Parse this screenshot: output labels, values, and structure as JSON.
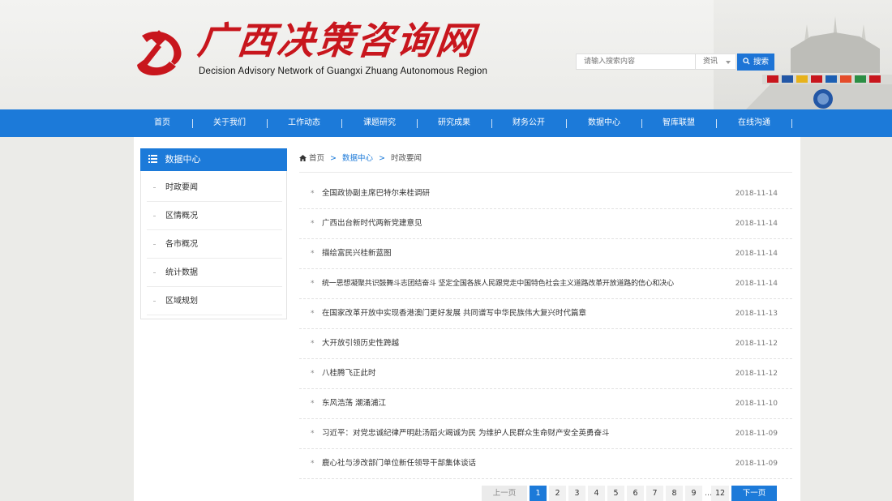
{
  "header": {
    "logo_title": "广西决策咨询网",
    "logo_subtitle": "Decision Advisory Network of Guangxi Zhuang Autonomous Region",
    "search_placeholder": "请输入搜索内容",
    "search_scope": "资讯",
    "search_button": "搜索"
  },
  "nav": {
    "items": [
      "首页",
      "关于我们",
      "工作动态",
      "课题研究",
      "研究成果",
      "财务公开",
      "数据中心",
      "智库联盟",
      "在线沟通"
    ]
  },
  "sidebar": {
    "title": "数据中心",
    "items": [
      "时政要闻",
      "区情概况",
      "各市概况",
      "统计数据",
      "区域规划"
    ]
  },
  "breadcrumb": {
    "home": "首页",
    "section": "数据中心",
    "current": "时政要闻",
    "separator": ">"
  },
  "news": [
    {
      "title": "全国政协副主席巴特尔来桂调研",
      "date": "2018-11-14"
    },
    {
      "title": "广西出台新时代两新党建意见",
      "date": "2018-11-14"
    },
    {
      "title": "描绘富民兴桂新蓝图",
      "date": "2018-11-14"
    },
    {
      "title": "统一思想凝聚共识鼓舞斗志团结奋斗 坚定全国各族人民跟党走中国特色社会主义道路改革开放道路的信心和决心",
      "date": "2018-11-14"
    },
    {
      "title": "在国家改革开放中实现香港澳门更好发展 共同谱写中华民族伟大复兴时代篇章",
      "date": "2018-11-13"
    },
    {
      "title": "大开放引领历史性跨越",
      "date": "2018-11-12"
    },
    {
      "title": "八桂腾飞正此时",
      "date": "2018-11-12"
    },
    {
      "title": "东风浩荡 潮涌浦江",
      "date": "2018-11-10"
    },
    {
      "title": "习近平：对党忠诚纪律严明赴汤蹈火竭诚为民 为维护人民群众生命财产安全英勇奋斗",
      "date": "2018-11-09"
    },
    {
      "title": "鹿心社与涉改部门单位新任领导干部集体谈话",
      "date": "2018-11-09"
    }
  ],
  "pagination": {
    "prev": "上一页",
    "pages": [
      "1",
      "2",
      "3",
      "4",
      "5",
      "6",
      "7",
      "8",
      "9"
    ],
    "ellipsis": "...",
    "last": "12",
    "next": "下一页",
    "current": "1"
  },
  "colors": {
    "primary_blue": "#1c7ad9",
    "logo_red": "#c8161d"
  },
  "icons": {
    "emblem": "party-emblem-icon",
    "search": "search-icon",
    "list": "list-icon",
    "home": "home-icon"
  }
}
